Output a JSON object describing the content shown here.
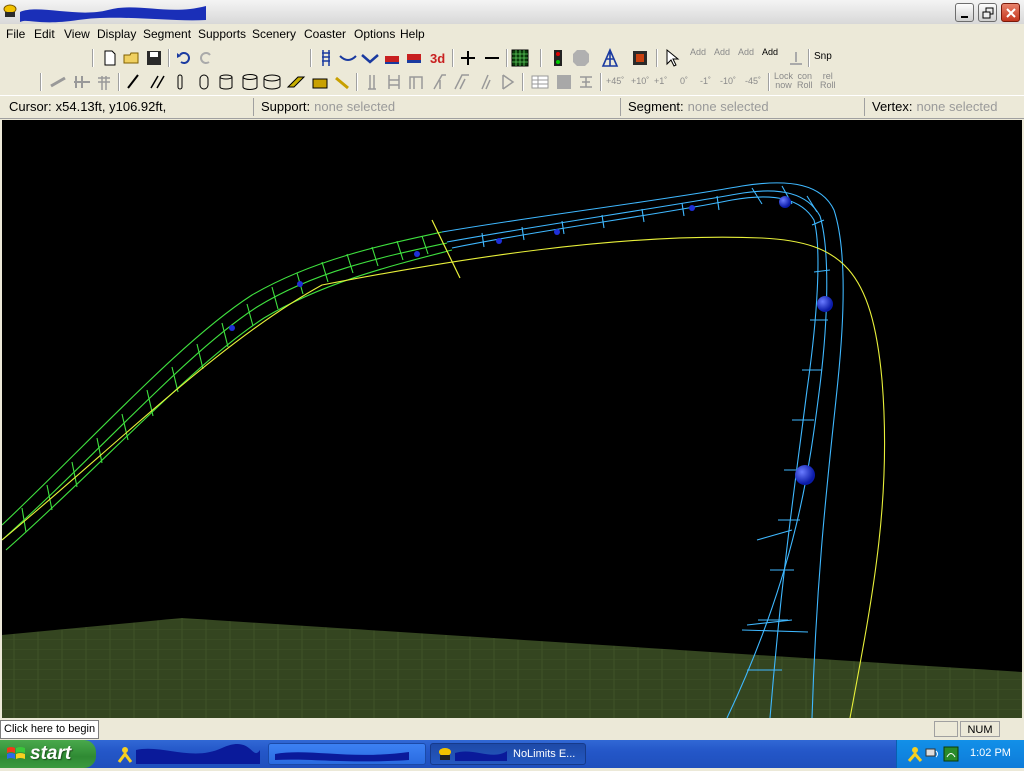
{
  "menu": [
    "File",
    "Edit",
    "View",
    "Display",
    "Segment",
    "Supports",
    "Scenery",
    "Coaster",
    "Options",
    "Help"
  ],
  "toolbar2_labels": {
    "p45": "+45˚",
    "p10": "+10˚",
    "p1": "+1˚",
    "zero": "0˚",
    "m1": "-1˚",
    "m10": "-10˚",
    "m45": "-45˚",
    "lock": "Lock\nnow",
    "con_roll": "con\nRoll",
    "rel_roll": "rel\nRoll"
  },
  "toolbar1_labels": {
    "add1": "Add",
    "add2": "Add",
    "add3": "Add",
    "add4": "Add",
    "snp": "Snp",
    "three_d": "3d"
  },
  "info": {
    "cursor_label": "Cursor:",
    "cursor_value": "x54.13ft, y106.92ft,",
    "support_label": "Support:",
    "support_value": "none selected",
    "segment_label": "Segment:",
    "segment_value": "none selected",
    "vertex_label": "Vertex:",
    "vertex_value": "none selected"
  },
  "status": {
    "hint": "Click here to begin",
    "num": "NUM"
  },
  "taskbar": {
    "start": "start",
    "task_app": "NoLimits E...",
    "clock": "1:02 PM"
  },
  "colors": {
    "track_selected": "#3fe03f",
    "track": "#3fb8ff",
    "heartline": "#e8f03a",
    "ground": "#3a4a22",
    "node": "#1e2fd8"
  }
}
